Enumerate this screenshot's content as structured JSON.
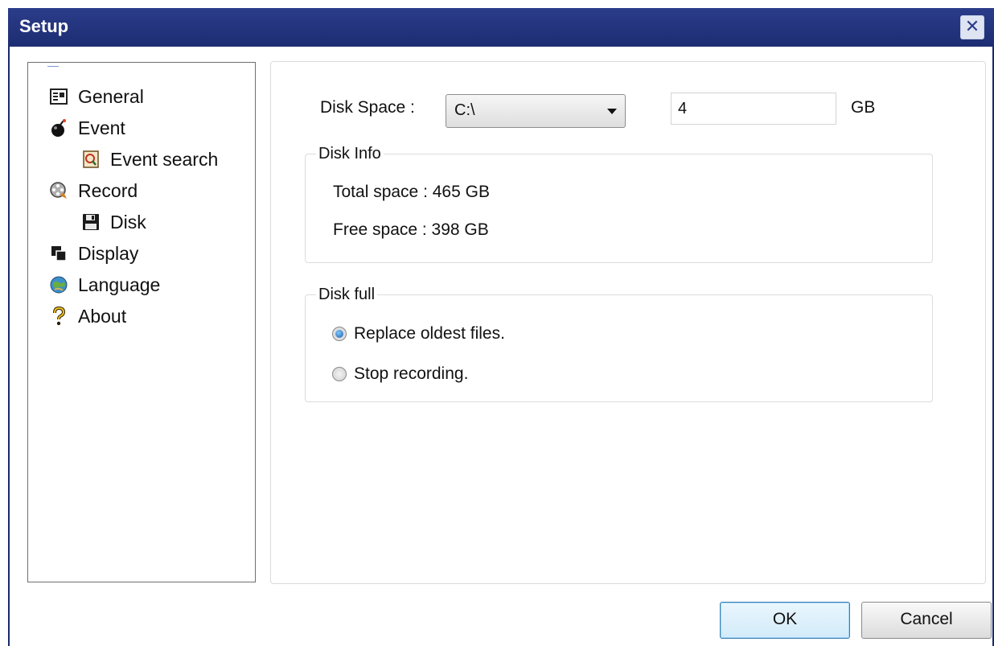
{
  "window": {
    "title": "Setup",
    "close_glyph": "✕"
  },
  "tree": {
    "items": [
      {
        "label": "General",
        "icon": "general-settings-icon"
      },
      {
        "label": "Event",
        "icon": "bomb-icon"
      },
      {
        "label": "Event search",
        "icon": "event-search-icon"
      },
      {
        "label": "Record",
        "icon": "film-reel-icon"
      },
      {
        "label": "Disk",
        "icon": "floppy-disk-icon"
      },
      {
        "label": "Display",
        "icon": "display-windows-icon"
      },
      {
        "label": "Language",
        "icon": "globe-icon"
      },
      {
        "label": "About",
        "icon": "question-mark-icon"
      }
    ]
  },
  "disk_space": {
    "label": "Disk Space :",
    "drive": "C:\\",
    "size_value": "4",
    "unit": "GB"
  },
  "disk_info": {
    "legend": "Disk Info",
    "total": "Total space : 465 GB",
    "free": "Free space : 398 GB"
  },
  "disk_full": {
    "legend": "Disk full",
    "options": [
      {
        "label": "Replace oldest files.",
        "checked": true
      },
      {
        "label": "Stop recording.",
        "checked": false
      }
    ]
  },
  "buttons": {
    "ok": "OK",
    "cancel": "Cancel"
  }
}
